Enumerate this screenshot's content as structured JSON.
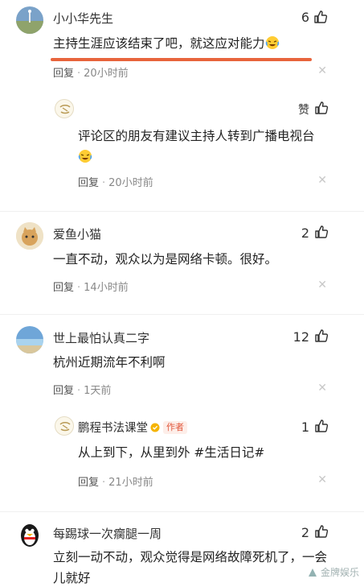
{
  "comments": [
    {
      "username": "小小华先生",
      "likes": "6",
      "text": "主持生涯应该结束了吧，就这应对能力",
      "reply": "回复",
      "time": "20小时前",
      "replies": [
        {
          "username": "",
          "likes": "赞",
          "text": "评论区的朋友有建议主持人转到广播电视台",
          "reply": "回复",
          "time": "20小时前"
        }
      ]
    },
    {
      "username": "爱鱼小猫",
      "likes": "2",
      "text": "一直不动，观众以为是网络卡顿。很好。",
      "reply": "回复",
      "time": "14小时前"
    },
    {
      "username": "世上最怕认真二字",
      "likes": "12",
      "text": "杭州近期流年不利啊",
      "reply": "回复",
      "time": "1天前",
      "replies": [
        {
          "username": "鹏程书法课堂",
          "badge": "作者",
          "likes": "1",
          "text": "从上到下，从里到外 #生活日记#",
          "reply": "回复",
          "time": "21小时前"
        }
      ]
    },
    {
      "username": "每踢球一次瘸腿一周",
      "likes": "2",
      "text": "立刻一动不动，观众觉得是网络故障死机了，一会儿就好"
    }
  ],
  "icons": {
    "like": "thumb-up-icon",
    "close": "close-icon",
    "emoji": "laugh-cry-emoji-icon"
  },
  "colors": {
    "underline": "#e8643c",
    "author_badge": "#e2593e"
  },
  "watermark": "金牌娱乐"
}
